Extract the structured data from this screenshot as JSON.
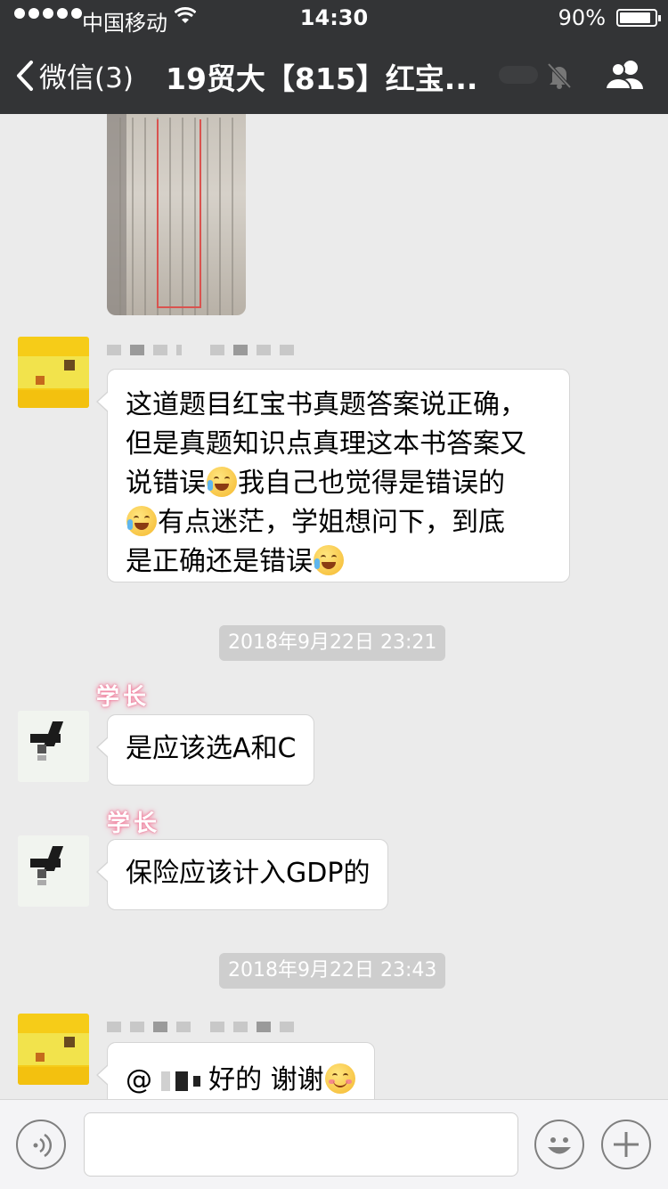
{
  "status_bar": {
    "carrier": "中国移动",
    "time": "14:30",
    "battery": "90%"
  },
  "nav": {
    "back_label": "微信(3)",
    "title": "19贸大【815】红宝..."
  },
  "messages": [
    {
      "type": "text",
      "segments": [
        "这道题目红宝书真题答案说正确，",
        "但是真题知识点真理这本书答案又",
        "说错误",
        "我自己也觉得是错误的",
        "有点迷茫，学姐想问下，到底",
        "是正确还是错误"
      ]
    },
    {
      "type": "timestamp",
      "text": "2018年9月22日 23:21"
    },
    {
      "type": "text",
      "sender": "学长",
      "text": "是应该选A和C"
    },
    {
      "type": "text",
      "sender": "学长",
      "text": "保险应该计入GDP的"
    },
    {
      "type": "timestamp",
      "text": "2018年9月22日 23:43"
    },
    {
      "type": "text",
      "mention_prefix": "@",
      "text": "好的 谢谢"
    }
  ],
  "icons": {
    "back": "chevron-left-icon",
    "mute": "bell-off-icon",
    "group": "group-icon",
    "voice": "voice-icon",
    "emoji": "emoji-icon",
    "plus": "plus-icon"
  },
  "colors": {
    "nav_bg": "#333436",
    "chat_bg": "#ebebeb",
    "timestamp_bg": "#cecece",
    "sender_glow": "#f07c9a"
  }
}
